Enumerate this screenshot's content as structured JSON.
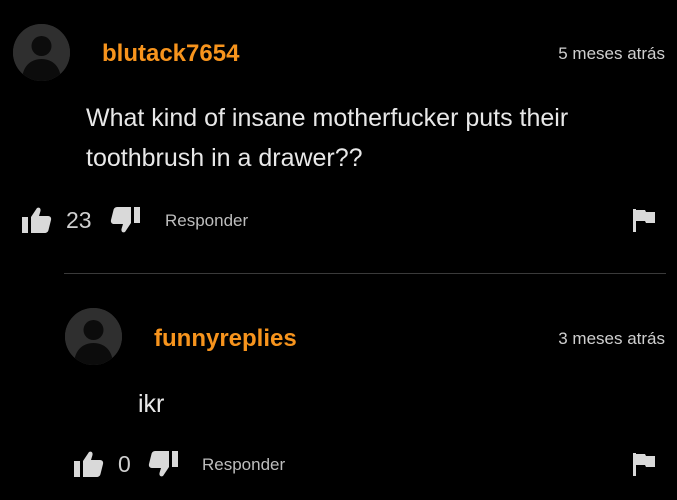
{
  "colors": {
    "background": "#000000",
    "username": "#f7941d",
    "text": "#e8e8e8",
    "muted": "#cfcfcf",
    "avatar": "#2f2f2f",
    "divider": "#3a3a3a"
  },
  "comments": [
    {
      "username": "blutack7654",
      "timestamp": "5 meses atrás",
      "text_lines": [
        "What kind of insane motherfucker puts their",
        "toothbrush in a drawer??"
      ],
      "like_count": "23",
      "reply_label": "Responder",
      "icons": [
        "avatar-silhouette",
        "thumbs-up-icon",
        "thumbs-down-icon",
        "flag-icon"
      ]
    },
    {
      "username": "funnyreplies",
      "timestamp": "3 meses atrás",
      "text_lines": [
        "ikr"
      ],
      "like_count": "0",
      "reply_label": "Responder",
      "icons": [
        "avatar-silhouette",
        "thumbs-up-icon",
        "thumbs-down-icon",
        "flag-icon"
      ]
    }
  ]
}
